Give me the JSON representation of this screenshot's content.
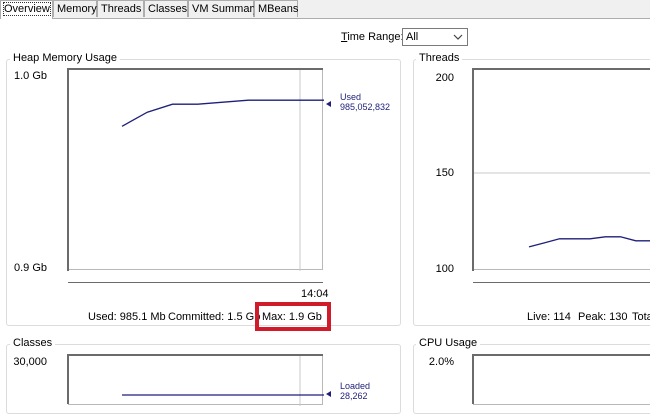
{
  "tabs": [
    "Overview",
    "Memory",
    "Threads",
    "Classes",
    "VM Summary",
    "MBeans"
  ],
  "active_tab": "Overview",
  "time_range": {
    "label_prefix": "",
    "label_mnemonic": "T",
    "label_rest": "ime Range:",
    "value": "All"
  },
  "heap": {
    "title": "Heap Memory Usage",
    "y_max_label": "1.0 Gb",
    "y_min_label": "0.9 Gb",
    "x_label": "14:04",
    "series_name": "Used",
    "series_value": "985,052,832",
    "stats": {
      "used": "Used: 985.1 Mb",
      "committed": "Committed: 1.5 Gb",
      "max": "Max: 1.9 Gb"
    }
  },
  "threads": {
    "title": "Threads",
    "y_labels": [
      "200",
      "150",
      "100"
    ],
    "stats": {
      "live": "Live: 114",
      "peak": "Peak: 130",
      "total": "Tota"
    }
  },
  "classes": {
    "title": "Classes",
    "y_max_label": "30,000",
    "series_name": "Loaded",
    "series_value": "28,262"
  },
  "cpu": {
    "title": "CPU Usage",
    "y_max_label": "2.0%"
  },
  "colors": {
    "series": "#1f1f7a",
    "highlight": "#d01b2a"
  },
  "chart_data": [
    {
      "type": "line",
      "title": "Heap Memory Usage",
      "ylim": [
        0.9,
        1.0
      ],
      "unit": "Gb",
      "series": [
        {
          "name": "Used",
          "values": [
            0.972,
            0.979,
            0.983,
            0.983,
            0.984,
            0.985,
            0.985,
            0.985,
            0.985
          ]
        }
      ]
    },
    {
      "type": "line",
      "title": "Threads",
      "ylim": [
        100,
        200
      ],
      "series": [
        {
          "name": "",
          "values": [
            112,
            114,
            116,
            116,
            116,
            117,
            117,
            115,
            115
          ]
        }
      ]
    }
  ]
}
